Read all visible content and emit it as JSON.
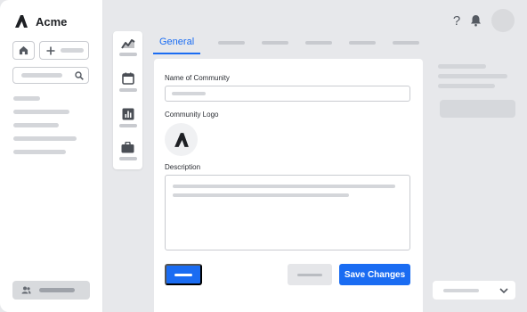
{
  "brand": {
    "name": "Acme"
  },
  "tabs": {
    "active_label": "General"
  },
  "form": {
    "name_label": "Name of Community",
    "logo_label": "Community Logo",
    "description_label": "Description",
    "save_label": "Save Changes"
  },
  "icons": {
    "brand": "acme-logo-icon",
    "home": "home-icon",
    "add": "plus-icon",
    "search": "search-icon",
    "users": "users-icon",
    "help": "help-icon",
    "notifications": "bell-icon",
    "rail": [
      "activity-chart-icon",
      "calendar-icon",
      "bar-chart-icon",
      "briefcase-icon"
    ],
    "dropdown": "chevron-down-icon"
  },
  "colors": {
    "accent": "#1a6cf2",
    "background": "#e7e8eb",
    "card": "#ffffff",
    "placeholder": "#d4d6da"
  }
}
